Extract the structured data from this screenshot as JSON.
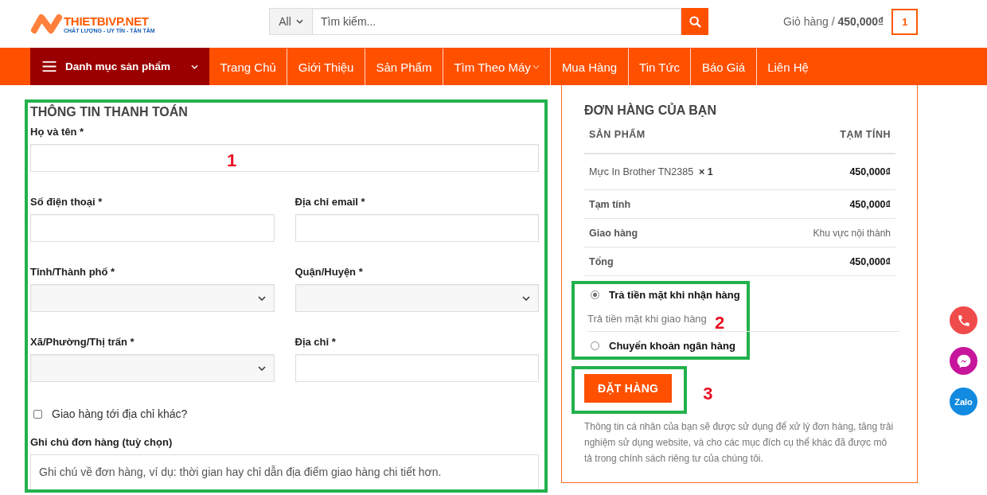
{
  "header": {
    "logo": {
      "name": "THIETBIVP.NET",
      "tagline": "CHẤT LƯỢNG - UY TÍN - TẬN TÂM"
    },
    "search": {
      "category": "All",
      "placeholder": "Tìm kiếm..."
    },
    "cart": {
      "label": "Giỏ hàng /",
      "total": "450,000₫",
      "count": "1"
    }
  },
  "nav": {
    "category_button": "Danh mục sản phẩm",
    "items": [
      {
        "label": "Trang Chủ",
        "has_dropdown": false
      },
      {
        "label": "Giới Thiệu",
        "has_dropdown": false
      },
      {
        "label": "Sản Phẩm",
        "has_dropdown": false
      },
      {
        "label": "Tìm Theo Máy",
        "has_dropdown": true
      },
      {
        "label": "Mua Hàng",
        "has_dropdown": false
      },
      {
        "label": "Tin Tức",
        "has_dropdown": false
      },
      {
        "label": "Báo Giá",
        "has_dropdown": false
      },
      {
        "label": "Liên Hệ",
        "has_dropdown": false
      }
    ]
  },
  "billing": {
    "title": "THÔNG TIN THANH TOÁN",
    "rows": [
      [
        {
          "label": "Họ và tên *",
          "kind": "input"
        }
      ],
      [
        {
          "label": "Số điện thoại *",
          "kind": "input"
        },
        {
          "label": "Địa chỉ email *",
          "kind": "input"
        }
      ],
      [
        {
          "label": "Tỉnh/Thành phố *",
          "kind": "select"
        },
        {
          "label": "Quận/Huyện *",
          "kind": "select"
        }
      ],
      [
        {
          "label": "Xã/Phường/Thị trấn *",
          "kind": "select"
        },
        {
          "label": "Địa chỉ *",
          "kind": "input"
        }
      ]
    ],
    "ship_to_different": {
      "label": "Giao hàng tới địa chỉ khác?",
      "checked": false
    },
    "notes": {
      "label": "Ghi chú đơn hàng (tuỳ chọn)",
      "placeholder": "Ghi chú về đơn hàng, ví dụ: thời gian hay chỉ dẫn địa điểm giao hàng chi tiết hơn."
    }
  },
  "order": {
    "title": "ĐƠN HÀNG CỦA BẠN",
    "columns": [
      "SẢN PHẨM",
      "TẠM TÍNH"
    ],
    "item": {
      "name": "Mực In Brother TN2385",
      "quantity": "× 1",
      "total": "450,000₫"
    },
    "totals": [
      {
        "label": "Tạm tính",
        "value": "450,000₫",
        "kind": "amount"
      },
      {
        "label": "Giao hàng",
        "value": "Khu vực nội thành",
        "kind": "text"
      },
      {
        "label": "Tổng",
        "value": "450,000₫",
        "kind": "amount"
      }
    ],
    "payment_methods": [
      {
        "label": "Trả tiền mặt khi nhận hàng",
        "selected": true,
        "description": "Trả tiền mặt khi giao hàng"
      },
      {
        "label": "Chuyển khoản ngân hàng",
        "selected": false
      }
    ],
    "place_order": "ĐẶT HÀNG",
    "privacy": "Thông tin cá nhân của bạn sẽ được sử dụng để xử lý đơn hàng, tăng trải nghiệm sử dụng website, và cho các mục đích cụ thể khác đã được mô tả trong chính sách riêng tư của chúng tôi."
  },
  "annotations": [
    {
      "label": "1"
    },
    {
      "label": "2"
    },
    {
      "label": "3"
    }
  ],
  "floating_buttons": [
    {
      "kind": "phone"
    },
    {
      "kind": "messenger"
    },
    {
      "kind": "zalo",
      "label": "Zalo"
    }
  ]
}
